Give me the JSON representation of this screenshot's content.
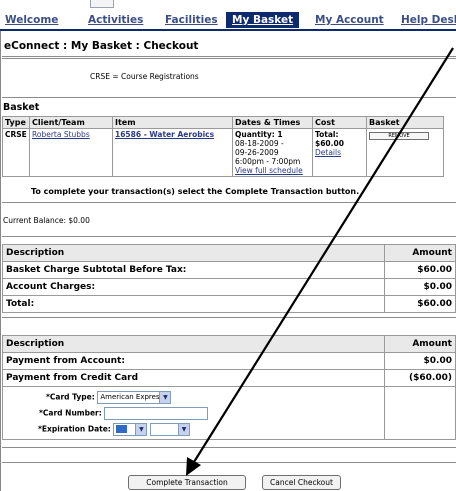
{
  "tabs": [
    {
      "label": "Welcome"
    },
    {
      "label": "Activities"
    },
    {
      "label": "Facilities"
    },
    {
      "label": "My Basket"
    },
    {
      "label": "My Account"
    },
    {
      "label": "Help Desk"
    }
  ],
  "header": {
    "title": "eConnect : My Basket : Checkout"
  },
  "legend_note": "CRSE = Course Registrations",
  "basket": {
    "title": "Basket",
    "columns": [
      "Type",
      "Client/Team",
      "Item",
      "Dates & Times",
      "Cost",
      "Basket"
    ],
    "row": {
      "type": "CRSE",
      "client": "Roberta Stubbs",
      "item_code": "16586",
      "item_name": " - Water Aerobics",
      "quantity": "Quantity: 1",
      "dates": "08-18-2009 -",
      "dates2": "09-26-2009",
      "time": "6:00pm - 7:00pm",
      "schedule_link": "View full schedule",
      "total": "Total: $60.00",
      "details_link": "Details",
      "remove_label": "REMOVE"
    }
  },
  "instruction": "To complete your transaction(s) select the Complete Transaction button.",
  "balance": "Current Balance: $0.00",
  "summary": {
    "header": [
      "Description",
      "Amount"
    ],
    "rows": [
      {
        "label": "Basket Charge Subtotal Before Tax:",
        "amount": "$60.00"
      },
      {
        "label": "Account Charges:",
        "amount": "$0.00"
      },
      {
        "label": "Total:",
        "amount": "$60.00"
      }
    ]
  },
  "payment": {
    "header": [
      "Description",
      "Amount"
    ],
    "rows": [
      {
        "label": "Payment from Account:",
        "amount": "$0.00"
      },
      {
        "label": "Payment from Credit Card",
        "amount": "($60.00)"
      }
    ],
    "card_type_label": "*Card Type:",
    "card_type_value": "American Express",
    "card_number_label": "*Card Number:",
    "card_number_value": "",
    "expiration_label": "*Expiration Date:"
  },
  "buttons": {
    "complete": "Complete Transaction",
    "cancel": "Cancel Checkout"
  },
  "colors": {
    "nav_dark": "#0d2a6e",
    "link": "#2a3a8a",
    "annotation_arrow": "#000000"
  }
}
